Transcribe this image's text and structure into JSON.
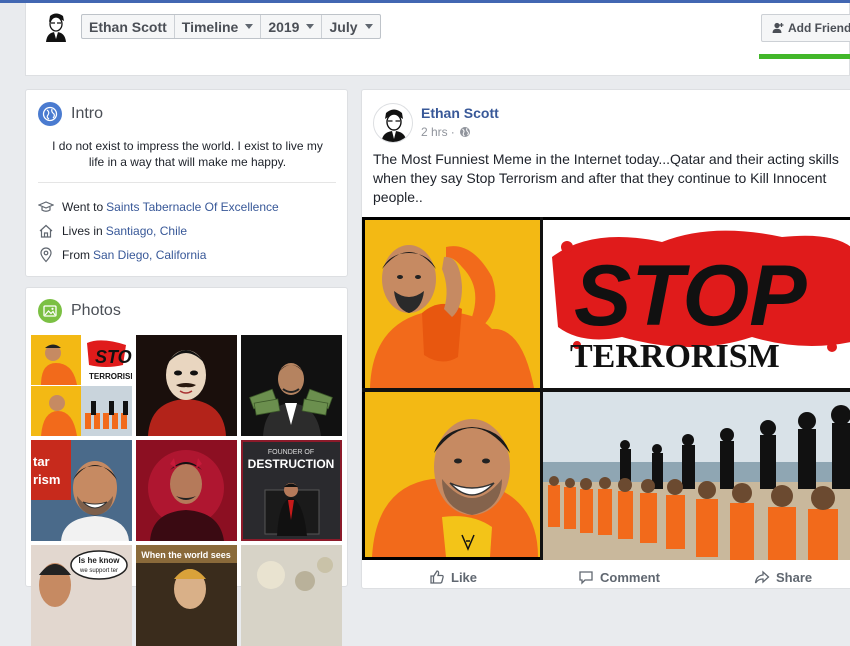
{
  "profile": {
    "name": "Ethan Scott"
  },
  "nav": {
    "name": "Ethan Scott",
    "timeline": "Timeline",
    "year": "2019",
    "month": "July"
  },
  "header": {
    "add_friend": "Add Friend"
  },
  "intro": {
    "title": "Intro",
    "bio": "I do not exist to impress the world. I exist to live my life in a way that will make me happy.",
    "items": [
      {
        "prefix": "Went to",
        "link": "Saints Tabernacle Of Excellence",
        "icon": "graduation-cap-icon"
      },
      {
        "prefix": "Lives in",
        "link": "Santiago, Chile",
        "icon": "home-icon"
      },
      {
        "prefix": "From",
        "link": "San Diego, California",
        "icon": "location-pin-icon"
      }
    ]
  },
  "photos": {
    "title": "Photos",
    "captions": {
      "founder_of": "FOUNDER OF",
      "destruction": "DESTRUCTION",
      "stop": "STOP",
      "terrorism": "TERRORISM",
      "tar": "tar",
      "rism": "rism",
      "is_he_know": "Is he know",
      "we_support": "we support ter",
      "world_sees": "When the world sees"
    }
  },
  "post": {
    "author": "Ethan Scott",
    "time": "2 hrs",
    "separator": "·",
    "text": "The Most Funniest Meme in the Internet today...Qatar and their acting skills when they say Stop Terrorism and after that they continue to Kill Innocent people..",
    "meme_text": {
      "stop": "STOP",
      "terrorism": "TERRORISM"
    },
    "actions": {
      "like": "Like",
      "comment": "Comment",
      "share": "Share"
    }
  },
  "colors": {
    "brand": "#4267b2",
    "link": "#385898",
    "green": "#42b72a",
    "orange": "#f26a1b"
  }
}
